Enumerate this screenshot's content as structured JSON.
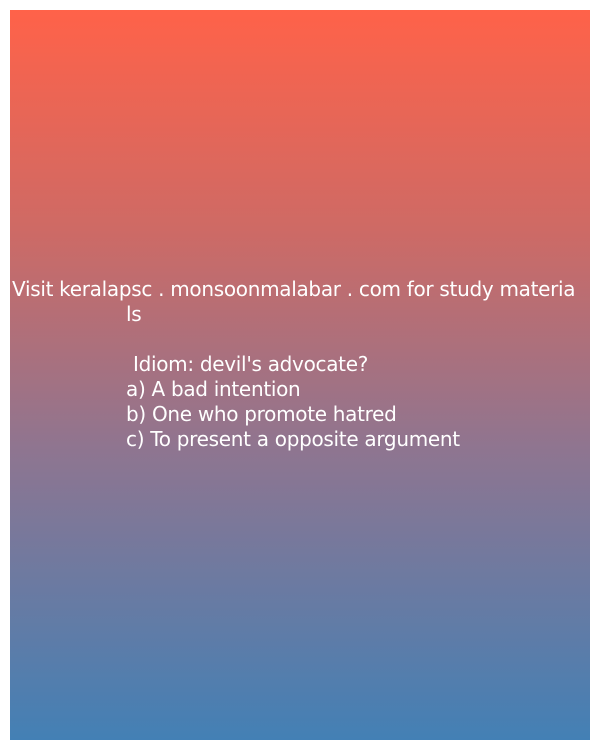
{
  "promo": {
    "line1": "Visit keralapsc . monsoonmalabar . com for study materia",
    "line2": "ls"
  },
  "question": "Idiom: devil's advocate?",
  "options": [
    "a) A bad intention",
    "b) One who promote hatred",
    "c) To present a opposite argument"
  ],
  "colors": {
    "gradient_top": "#ff6249",
    "gradient_bottom": "#4380b5",
    "text": "#ffffff"
  }
}
